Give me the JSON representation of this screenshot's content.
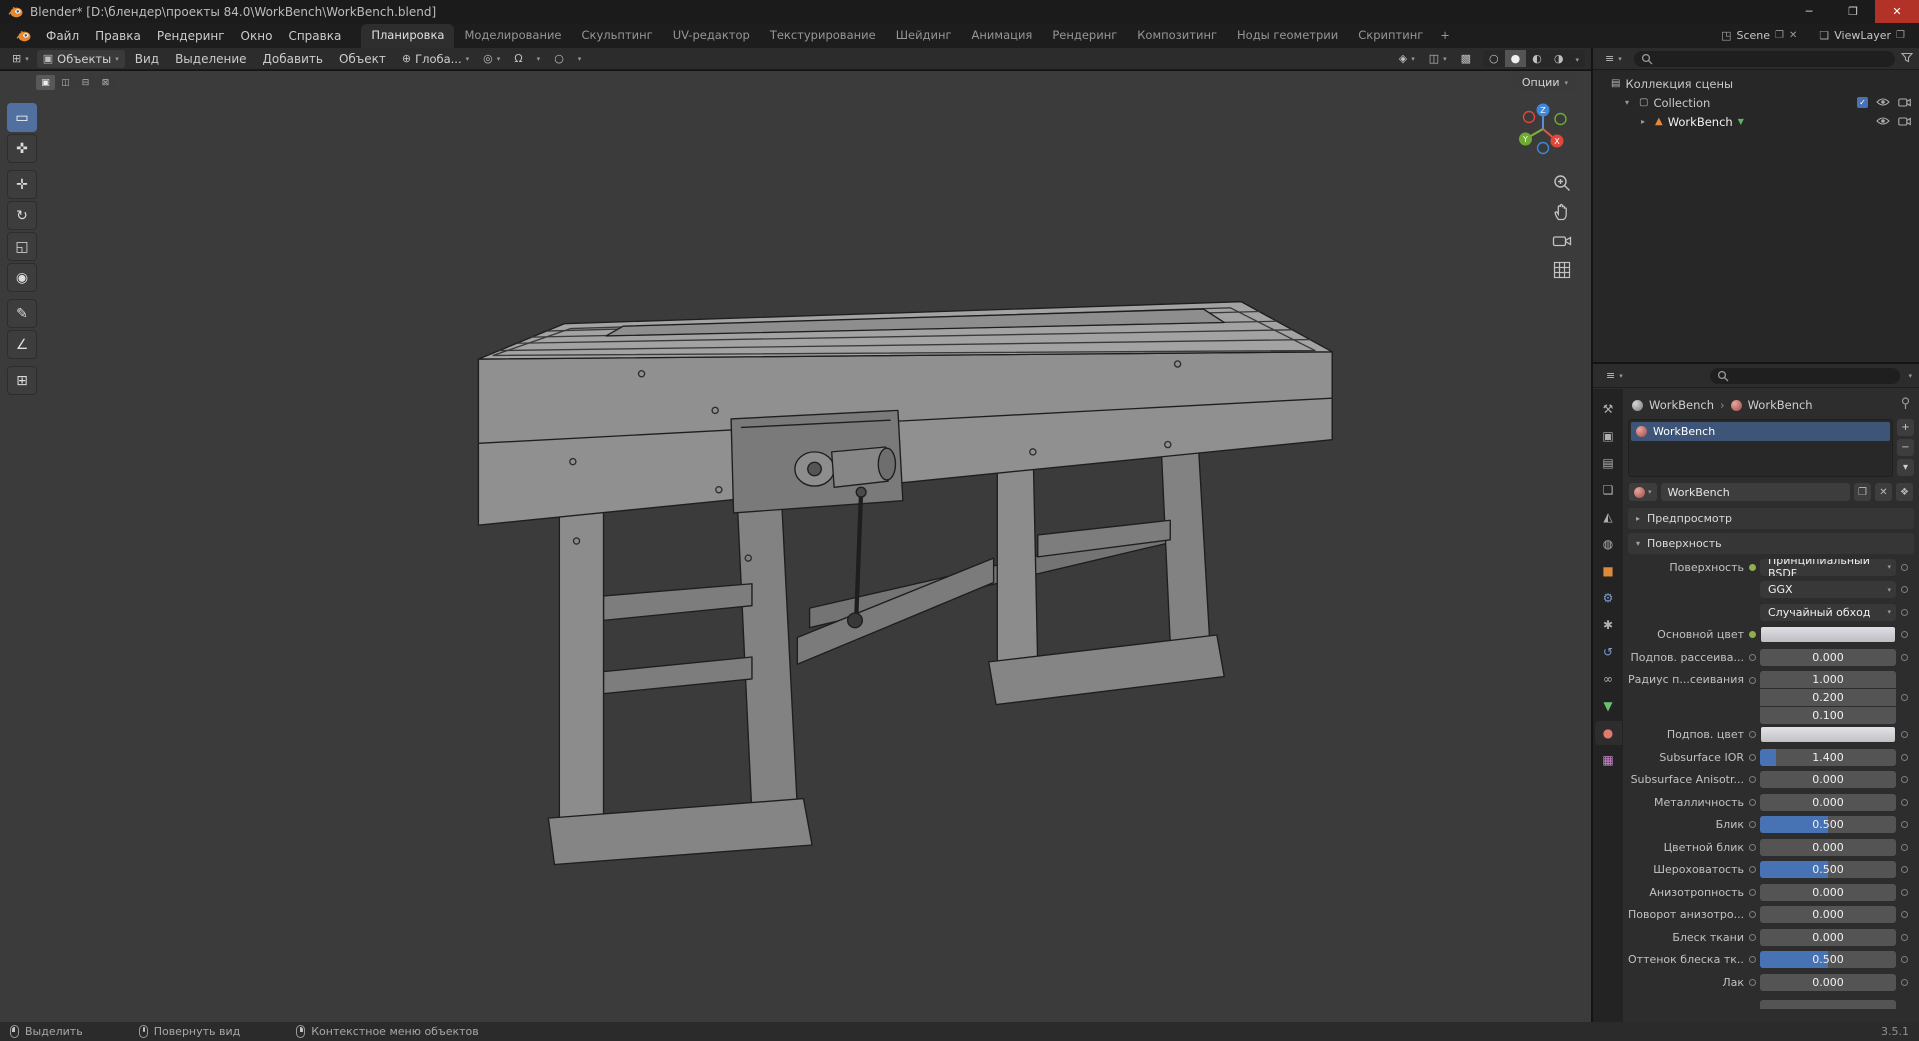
{
  "titlebar": {
    "title": "Blender* [D:\\блендер\\проекты 84.0\\WorkBench\\WorkBench.blend]",
    "minimize": "─",
    "maximize": "❐",
    "close": "✕"
  },
  "topbar": {
    "menus": [
      "Файл",
      "Правка",
      "Рендеринг",
      "Окно",
      "Справка"
    ],
    "workspaces": [
      "Планировка",
      "Моделирование",
      "Скульптинг",
      "UV-редактор",
      "Текстурирование",
      "Шейдинг",
      "Анимация",
      "Рендеринг",
      "Композитинг",
      "Ноды геометрии",
      "Скриптинг"
    ],
    "active_workspace": "Планировка",
    "add_workspace": "+",
    "scene_label": "Scene",
    "viewlayer_label": "ViewLayer"
  },
  "viewport": {
    "header": {
      "mode": "Объекты",
      "menus": [
        "Вид",
        "Выделение",
        "Добавить",
        "Объект"
      ],
      "orientation": "Глоба...",
      "options_label": "Опции"
    },
    "toolbar": [
      {
        "name": "select-box",
        "active": true
      },
      {
        "name": "cursor"
      },
      {
        "name": "move"
      },
      {
        "name": "rotate"
      },
      {
        "name": "scale"
      },
      {
        "name": "transform"
      },
      {
        "name": "annotate"
      },
      {
        "name": "measure"
      },
      {
        "name": "add-cube"
      }
    ],
    "select_modes": [
      {
        "name": "select-new",
        "active": true
      },
      {
        "name": "select-extend"
      },
      {
        "name": "select-subtract"
      },
      {
        "name": "select-intersect"
      }
    ],
    "nav": [
      {
        "name": "zoom"
      },
      {
        "name": "pan"
      },
      {
        "name": "camera-view"
      },
      {
        "name": "toggle-projection"
      }
    ],
    "gizmo_colors": {
      "x": "#e0473b",
      "y": "#6faa33",
      "z": "#3f87d9"
    }
  },
  "outliner": {
    "scene_collection": "Коллекция сцены",
    "collection": "Collection",
    "object": "WorkBench"
  },
  "properties": {
    "tabs": [
      {
        "name": "tool"
      },
      {
        "name": "render"
      },
      {
        "name": "output"
      },
      {
        "name": "view-layer"
      },
      {
        "name": "scene"
      },
      {
        "name": "world"
      },
      {
        "name": "object",
        "color": "#de8a3c"
      },
      {
        "name": "modifiers",
        "color": "#7c9fd0"
      },
      {
        "name": "particles"
      },
      {
        "name": "physics",
        "color": "#7c9fd0"
      },
      {
        "name": "constraints"
      },
      {
        "name": "object-data",
        "color": "#6cbf6c"
      },
      {
        "name": "material",
        "color": "#e07a70",
        "active": true
      },
      {
        "name": "texture",
        "color": "#d08ad0"
      }
    ],
    "breadcrumb": {
      "object": "WorkBench",
      "material": "WorkBench"
    },
    "slot_name": "WorkBench",
    "material_name": "WorkBench",
    "sections": {
      "preview": "Предпросмотр",
      "surface": "Поверхность"
    },
    "rows": [
      {
        "label": "Поверхность",
        "type": "shader",
        "value": "Принципиальный BSDF",
        "keyed": true
      },
      {
        "label": "",
        "type": "menu",
        "value": "GGX"
      },
      {
        "label": "",
        "type": "menu",
        "value": "Случайный обход"
      },
      {
        "label": "Основной цвет",
        "type": "color",
        "value": "#d8d8de",
        "keyed": true
      },
      {
        "label": "Подпов. рассеива...",
        "type": "slider",
        "value": "0.000",
        "fill": 0
      },
      {
        "label": "Радиус п...сеивания",
        "type": "vector",
        "values": [
          "1.000",
          "0.200",
          "0.100"
        ]
      },
      {
        "label": "Подпов. цвет",
        "type": "color",
        "value": "#dcdce2"
      },
      {
        "label": "Subsurface IOR",
        "type": "slider",
        "value": "1.400",
        "fill": 0.12
      },
      {
        "label": "Subsurface Anisotr...",
        "type": "slider",
        "value": "0.000",
        "fill": 0
      },
      {
        "label": "Металличность",
        "type": "slider",
        "value": "0.000",
        "fill": 0
      },
      {
        "label": "Блик",
        "type": "slider",
        "value": "0.500",
        "fill": 0.5
      },
      {
        "label": "Цветной блик",
        "type": "slider",
        "value": "0.000",
        "fill": 0
      },
      {
        "label": "Шероховатость",
        "type": "slider",
        "value": "0.500",
        "fill": 0.5
      },
      {
        "label": "Анизотропность",
        "type": "slider",
        "value": "0.000",
        "fill": 0
      },
      {
        "label": "Поворот анизотро...",
        "type": "slider",
        "value": "0.000",
        "fill": 0
      },
      {
        "label": "Блеск ткани",
        "type": "slider",
        "value": "0.000",
        "fill": 0
      },
      {
        "label": "Оттенок блеска тк...",
        "type": "slider",
        "value": "0.500",
        "fill": 0.5
      },
      {
        "label": "Лак",
        "type": "slider",
        "value": "0.000",
        "fill": 0
      }
    ]
  },
  "statusbar": {
    "hints": [
      {
        "label": "Выделить",
        "mouse": "left"
      },
      {
        "label": "Повернуть вид",
        "mouse": "middle"
      },
      {
        "label": "Контекстное меню объектов",
        "mouse": "right"
      }
    ],
    "version": "3.5.1"
  }
}
